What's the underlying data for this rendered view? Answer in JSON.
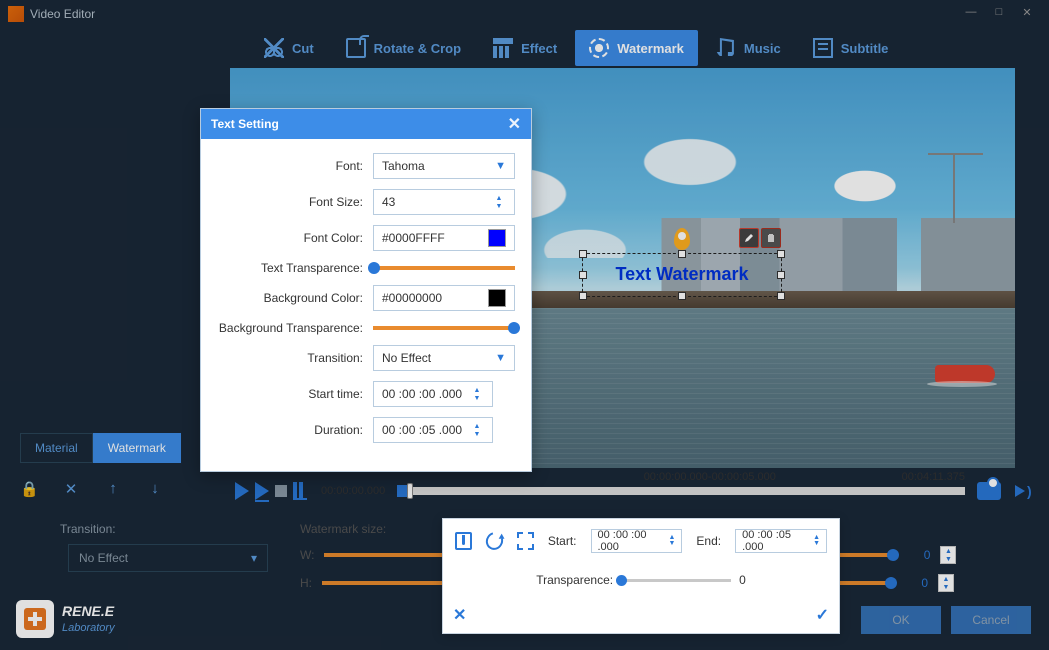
{
  "app": {
    "title": "Video Editor"
  },
  "toolbar": {
    "cut": "Cut",
    "rotate": "Rotate & Crop",
    "effect": "Effect",
    "watermark": "Watermark",
    "music": "Music",
    "subtitle": "Subtitle"
  },
  "left": {
    "tabs": {
      "material": "Material",
      "watermark": "Watermark"
    },
    "transition_label": "Transition:",
    "transition_value": "No Effect"
  },
  "brand": {
    "name": "RENE.E",
    "sub": "Laboratory"
  },
  "preview": {
    "watermark_text": "Text Watermark"
  },
  "playback": {
    "current": "00:00:00.000",
    "range": "00:00:00.000-00:00:05.000",
    "total": "00:04:11.375"
  },
  "sizes": {
    "title": "Watermark size:",
    "w_label": "W:",
    "w_value": "0",
    "h_label": "H:",
    "h_value": "0"
  },
  "dialog": {
    "title": "Text Setting",
    "font_label": "Font:",
    "font_value": "Tahoma",
    "fontsize_label": "Font Size:",
    "fontsize_value": "43",
    "fontcolor_label": "Font Color:",
    "fontcolor_value": "#0000FFFF",
    "fontcolor_swatch": "#0000ff",
    "texttrans_label": "Text Transparence:",
    "bgcolor_label": "Background Color:",
    "bgcolor_value": "#00000000",
    "bgcolor_swatch": "#000000",
    "bgtrans_label": "Background Transparence:",
    "transition_label": "Transition:",
    "transition_value": "No Effect",
    "start_label": "Start time:",
    "start_value": "00 :00 :00 .000",
    "duration_label": "Duration:",
    "duration_value": "00 :00 :05 .000"
  },
  "popup": {
    "start_label": "Start:",
    "start_value": "00 :00 :00 .000",
    "end_label": "End:",
    "end_value": "00 :00 :05 .000",
    "trans_label": "Transparence:",
    "trans_value": "0"
  },
  "buttons": {
    "ok": "OK",
    "cancel": "Cancel"
  }
}
